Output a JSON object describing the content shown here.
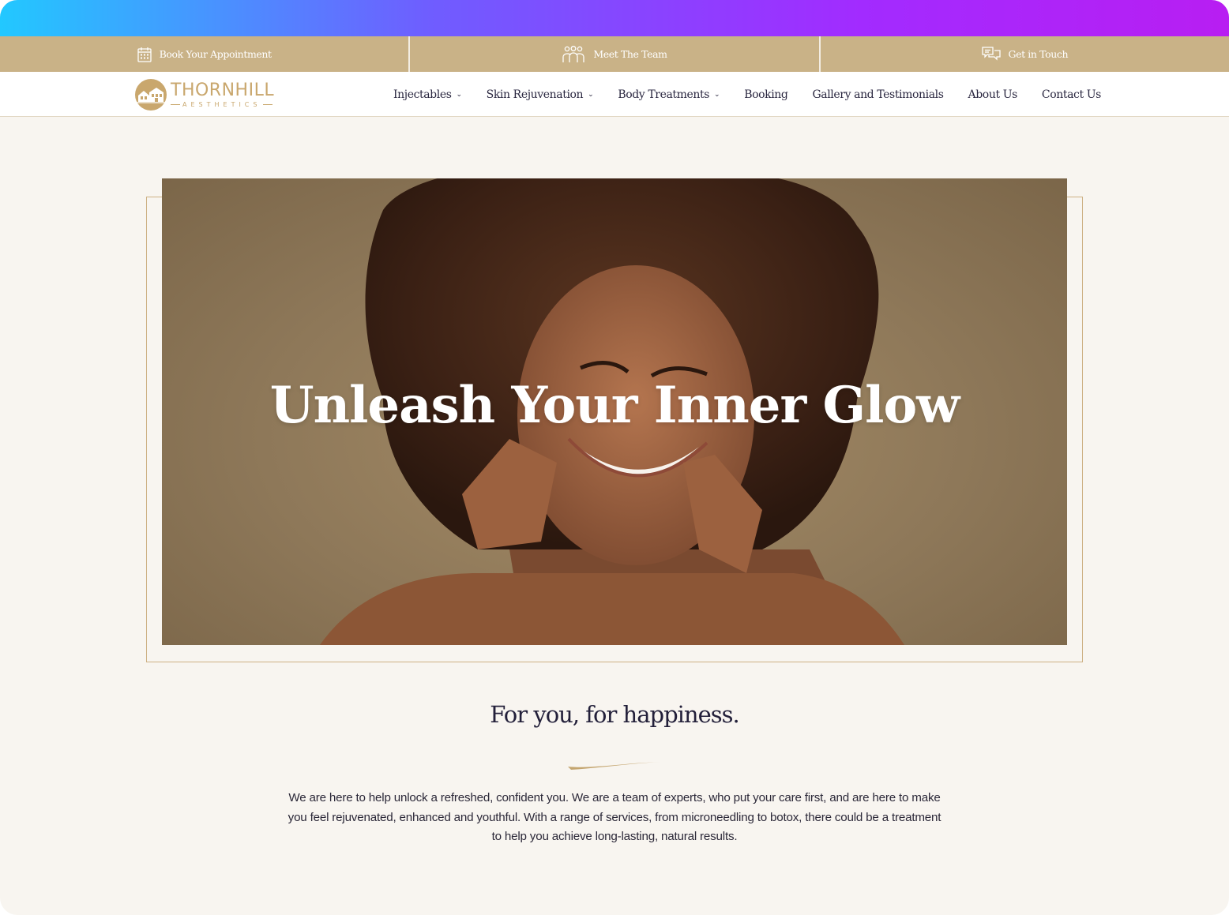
{
  "colors": {
    "gold": "#c9b287",
    "gold_line": "#cdb184",
    "ink": "#23203a",
    "cream": "#f8f5f0",
    "gradient_start": "#22c8ff",
    "gradient_end": "#b81ef2"
  },
  "topbar": {
    "items": [
      {
        "label": "Book Your Appointment",
        "icon": "calendar-icon"
      },
      {
        "label": "Meet The Team",
        "icon": "team-icon"
      },
      {
        "label": "Get in Touch",
        "icon": "chat-icon"
      }
    ]
  },
  "header": {
    "logo": {
      "name": "THORNHILL",
      "sub": "AESTHETICS",
      "icon": "house-logo-icon"
    },
    "nav": [
      {
        "label": "Injectables",
        "dropdown": true
      },
      {
        "label": "Skin Rejuvenation",
        "dropdown": true
      },
      {
        "label": "Body Treatments",
        "dropdown": true
      },
      {
        "label": "Booking",
        "dropdown": false
      },
      {
        "label": "Gallery and Testimonials",
        "dropdown": false
      },
      {
        "label": "About Us",
        "dropdown": false
      },
      {
        "label": "Contact Us",
        "dropdown": false
      }
    ]
  },
  "hero": {
    "title": "Unleash Your Inner Glow",
    "image": "smiling-woman-photo"
  },
  "intro": {
    "tagline": "For you, for happiness.",
    "body": "We are here to help unlock a refreshed, confident you. We are a team of experts, who put your care first, and are here to make you feel rejuvenated, enhanced and youthful. With a range of services, from microneedling to botox, there could be a treatment to help you achieve long-lasting, natural results."
  }
}
